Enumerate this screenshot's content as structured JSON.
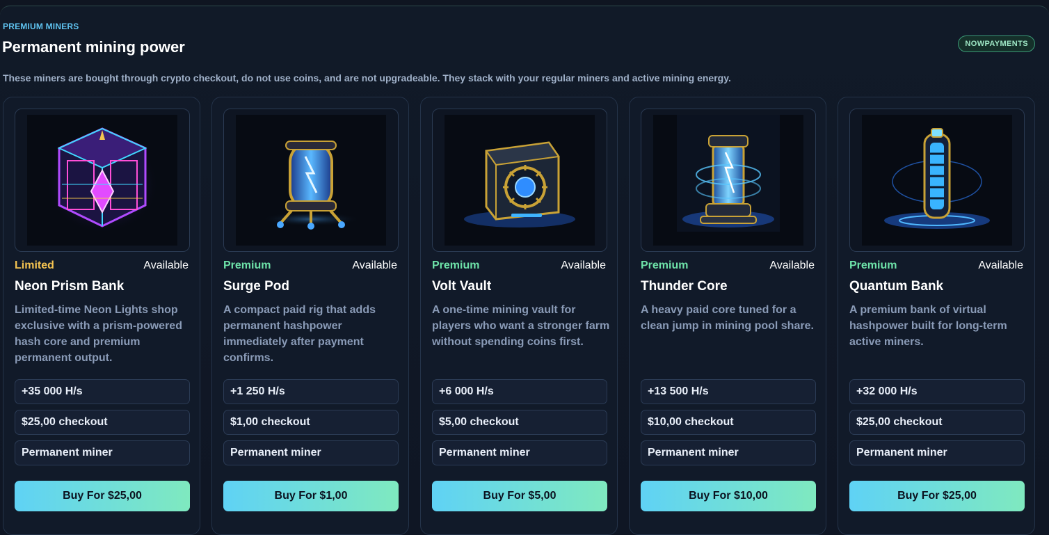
{
  "section": {
    "eyebrow": "PREMIUM MINERS",
    "title": "Permanent mining power",
    "badge": "NOWPAYMENTS",
    "description": "These miners are bought through crypto checkout, do not use coins, and are not upgradeable. They stack with your regular miners and active mining energy."
  },
  "colors": {
    "limited": "#f5c451",
    "premium": "#6ee3a9",
    "accent_start": "#5fd2f5",
    "accent_end": "#7fe9bf"
  },
  "miners": [
    {
      "tier": "Limited",
      "availability": "Available",
      "name": "Neon Prism Bank",
      "description": "Limited-time Neon Lights shop exclusive with a prism-powered hash core and premium permanent output.",
      "hashrate": "+35 000 H/s",
      "checkout": "$25,00 checkout",
      "type": "Permanent miner",
      "button": "Buy For $25,00",
      "icon": "neon-prism-cube-icon"
    },
    {
      "tier": "Premium",
      "availability": "Available",
      "name": "Surge Pod",
      "description": "A compact paid rig that adds permanent hashpower immediately after payment confirms.",
      "hashrate": "+1 250 H/s",
      "checkout": "$1,00 checkout",
      "type": "Permanent miner",
      "button": "Buy For $1,00",
      "icon": "surge-pod-capsule-icon"
    },
    {
      "tier": "Premium",
      "availability": "Available",
      "name": "Volt Vault",
      "description": "A one-time mining vault for players who want a stronger farm without spending coins first.",
      "hashrate": "+6 000 H/s",
      "checkout": "$5,00 checkout",
      "type": "Permanent miner",
      "button": "Buy For $5,00",
      "icon": "volt-vault-safe-icon"
    },
    {
      "tier": "Premium",
      "availability": "Available",
      "name": "Thunder Core",
      "description": "A heavy paid core tuned for a clean jump in mining pool share.",
      "hashrate": "+13 500 H/s",
      "checkout": "$10,00 checkout",
      "type": "Permanent miner",
      "button": "Buy For $10,00",
      "icon": "thunder-core-reactor-icon"
    },
    {
      "tier": "Premium",
      "availability": "Available",
      "name": "Quantum Bank",
      "description": "A premium bank of virtual hashpower built for long-term active miners.",
      "hashrate": "+32 000 H/s",
      "checkout": "$25,00 checkout",
      "type": "Permanent miner",
      "button": "Buy For $25,00",
      "icon": "quantum-bank-tower-icon"
    }
  ]
}
